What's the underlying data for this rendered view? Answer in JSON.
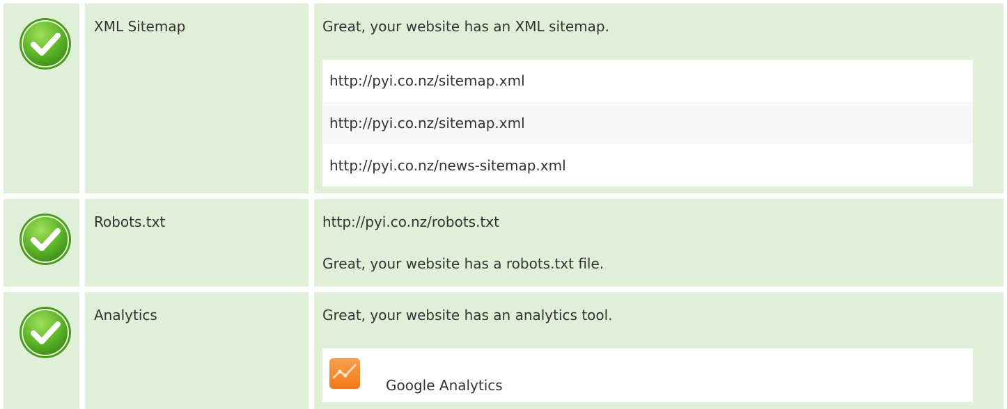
{
  "rows": [
    {
      "label": "XML Sitemap",
      "status": "check-icon",
      "message": "Great, your website has an XML sitemap.",
      "urls": [
        "http://pyi.co.nz/sitemap.xml",
        "http://pyi.co.nz/sitemap.xml",
        "http://pyi.co.nz/news-sitemap.xml"
      ]
    },
    {
      "label": "Robots.txt",
      "status": "check-icon",
      "url": "http://pyi.co.nz/robots.txt",
      "message": "Great, your website has a robots.txt file."
    },
    {
      "label": "Analytics",
      "status": "check-icon",
      "message": "Great, your website has an analytics tool.",
      "tools": [
        {
          "name": "Google Analytics",
          "icon": "google-analytics-logo-icon"
        }
      ]
    }
  ],
  "colors": {
    "row_background": "#dfefd8",
    "check_green": "#5cb328",
    "analytics_orange": "#f48120"
  }
}
